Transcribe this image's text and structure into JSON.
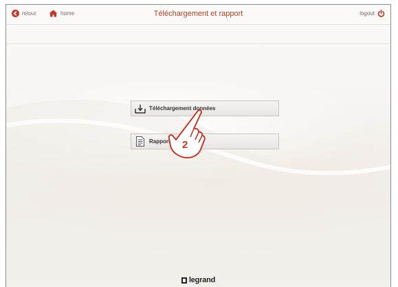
{
  "header": {
    "back_label": "retour",
    "home_label": "home",
    "title": "Téléchargement et rapport",
    "logout_label": "logout"
  },
  "menu": {
    "items": [
      {
        "label": "Téléchargement données",
        "icon": "download-tray-icon"
      },
      {
        "label": "Rapport",
        "icon": "document-icon"
      }
    ]
  },
  "annotation": {
    "step_number": "2"
  },
  "footer": {
    "brand": "legrand"
  },
  "colors": {
    "accent": "#b2402a",
    "icon_red": "#c0392b"
  }
}
